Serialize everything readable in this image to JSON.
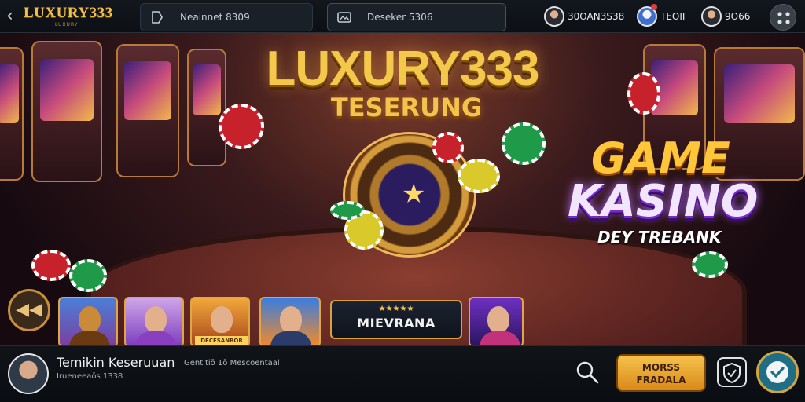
{
  "header": {
    "logo": "LUXURY333",
    "logo_sub": "LUXURY",
    "field1_text": "Neainnet 8309",
    "field2_text": "Deseker 5306",
    "users": [
      {
        "name": "30OAN3S38"
      },
      {
        "name": "TEOII"
      },
      {
        "name": "9O66"
      }
    ]
  },
  "hero": {
    "title": "LUXURY333",
    "subtitle": "TESERUNG"
  },
  "promo": {
    "line1": "GAME",
    "line2": "KASINO",
    "tagline": "DEY TREBANK"
  },
  "games": {
    "thumb3_caption": "DECESANBOR",
    "featured_stars": "★★★★★",
    "featured_label": "MIEVRANA"
  },
  "footer": {
    "title": "Temikin Keseruuan",
    "meta": "Gentitiō 1ō Mescoentaal",
    "sub": "Irueneeaōs 1338",
    "cta_line1": "MORSS",
    "cta_line2": "FRADALA"
  },
  "colors": {
    "gold": "#f4c84b",
    "purple": "#b66cff",
    "bar_bg": "#0c1015",
    "cta": "#f6c24b"
  },
  "icons": [
    "chevron-left-icon",
    "bookmark-icon",
    "image-icon",
    "search-icon",
    "shield-icon",
    "check-icon",
    "grid-menu-icon",
    "star-icon"
  ]
}
